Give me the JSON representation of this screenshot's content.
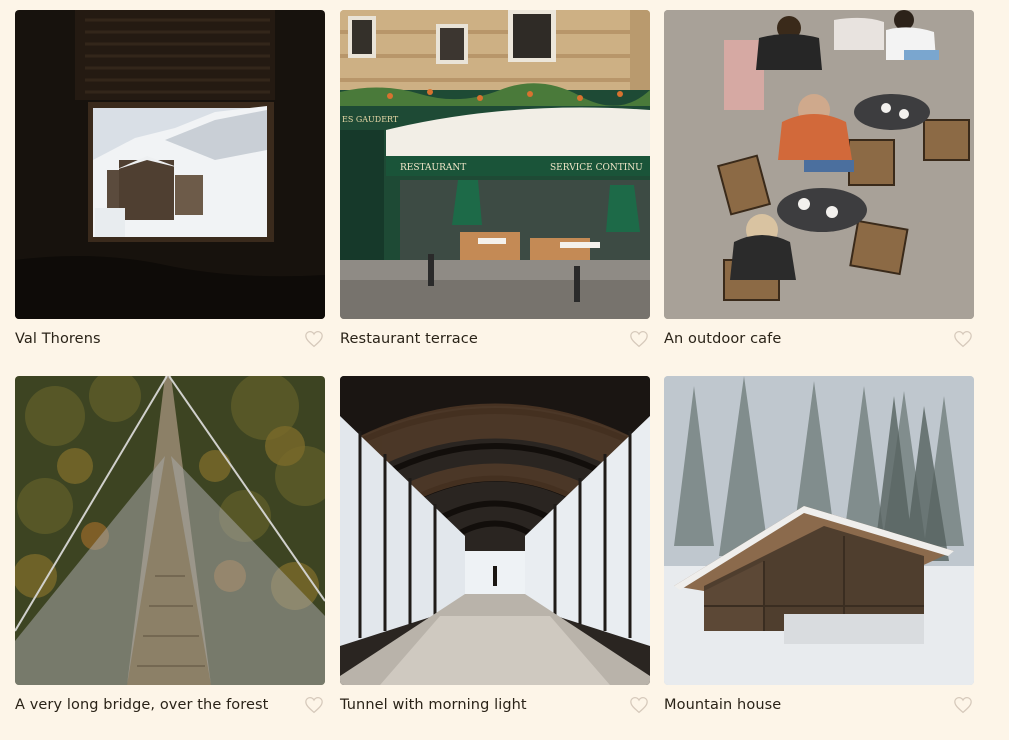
{
  "gallery": {
    "items": [
      {
        "title": "Val Thorens",
        "favorite_icon": "heart-outline-icon",
        "favorited": false
      },
      {
        "title": "Restaurant terrace",
        "favorite_icon": "heart-outline-icon",
        "favorited": false
      },
      {
        "title": "An outdoor cafe",
        "favorite_icon": "heart-outline-icon",
        "favorited": false
      },
      {
        "title": "A very long bridge, over the forest",
        "favorite_icon": "heart-outline-icon",
        "favorited": false
      },
      {
        "title": "Tunnel with morning light",
        "favorite_icon": "heart-outline-icon",
        "favorited": false
      },
      {
        "title": "Mountain house",
        "favorite_icon": "heart-outline-icon",
        "favorited": false
      }
    ],
    "photo_text": {
      "restaurant_sign_left": "RESTAURANT",
      "restaurant_sign_right": "SERVICE CONTINU",
      "restaurant_name": "ES GAUDERT"
    }
  },
  "colors": {
    "page_background": "#fdf5e8",
    "caption_text": "#2a2318",
    "heart_outline": "#d6c9bb"
  }
}
